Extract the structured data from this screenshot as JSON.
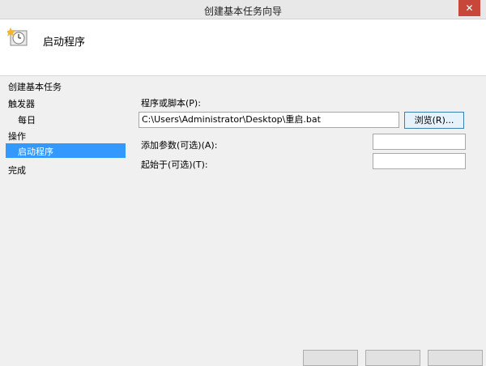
{
  "window": {
    "title": "创建基本任务向导",
    "close_glyph": "✕"
  },
  "header": {
    "title": "启动程序",
    "icon": "task-clock-icon"
  },
  "nav": {
    "items": [
      {
        "label": "创建基本任务"
      },
      {
        "label": "触发器"
      },
      {
        "label": "每日"
      },
      {
        "label": "操作"
      },
      {
        "label": "启动程序",
        "selected": true
      },
      {
        "label": "完成"
      }
    ]
  },
  "form": {
    "program_label": "程序或脚本(P):",
    "program_value": "C:\\Users\\Administrator\\Desktop\\重启.bat",
    "browse_label": "浏览(R)...",
    "args_label": "添加参数(可选)(A):",
    "args_value": "",
    "startin_label": "起始于(可选)(T):",
    "startin_value": ""
  },
  "colors": {
    "selection": "#3399ff",
    "close": "#c7483b"
  }
}
